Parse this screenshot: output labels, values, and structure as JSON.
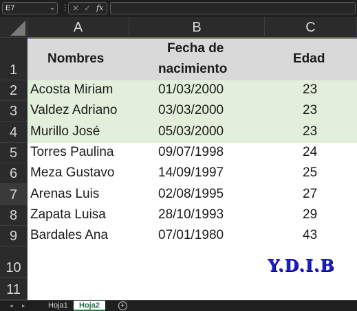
{
  "formula_bar": {
    "name_box": "E7",
    "name_box_arrow": "⌄",
    "separator": "⋮",
    "cancel_icon": "✕",
    "enter_icon": "✓",
    "function_label": "fx",
    "formula": ""
  },
  "columns": [
    "A",
    "B",
    "C"
  ],
  "rows": [
    "1",
    "2",
    "3",
    "4",
    "5",
    "6",
    "7",
    "8",
    "9",
    "10",
    "11"
  ],
  "selected_row": "7",
  "table": {
    "headers": {
      "name": "Nombres",
      "date_line1": "Fecha de",
      "date_line2": "nacimiento",
      "age": "Edad"
    },
    "records": [
      {
        "name": "Acosta Miriam",
        "date": "01/03/2000",
        "age": "23"
      },
      {
        "name": "Valdez Adriano",
        "date": "03/03/2000",
        "age": "23"
      },
      {
        "name": "Murillo José",
        "date": "05/03/2000",
        "age": "23"
      },
      {
        "name": "Torres Paulina",
        "date": "09/07/1998",
        "age": "24"
      },
      {
        "name": "Meza Gustavo",
        "date": "14/09/1997",
        "age": "25"
      },
      {
        "name": "Arenas Luis",
        "date": "02/08/1995",
        "age": "27"
      },
      {
        "name": "Zapata Luisa",
        "date": "28/10/1993",
        "age": "29"
      },
      {
        "name": "Bardales Ana",
        "date": "07/01/1980",
        "age": "43"
      }
    ],
    "header_fill": "#d9d9d9",
    "highlight_fill": "#e2efda"
  },
  "watermark": "Y.D.I.B",
  "sheet_tabs": {
    "prev_icon": "◂",
    "next_icon": "▸",
    "tabs": [
      "Hoja1",
      "Hoja2"
    ],
    "active": "Hoja2",
    "add_icon": "+"
  },
  "colors": {
    "accent": "#217346",
    "watermark": "#1c1ccf"
  }
}
